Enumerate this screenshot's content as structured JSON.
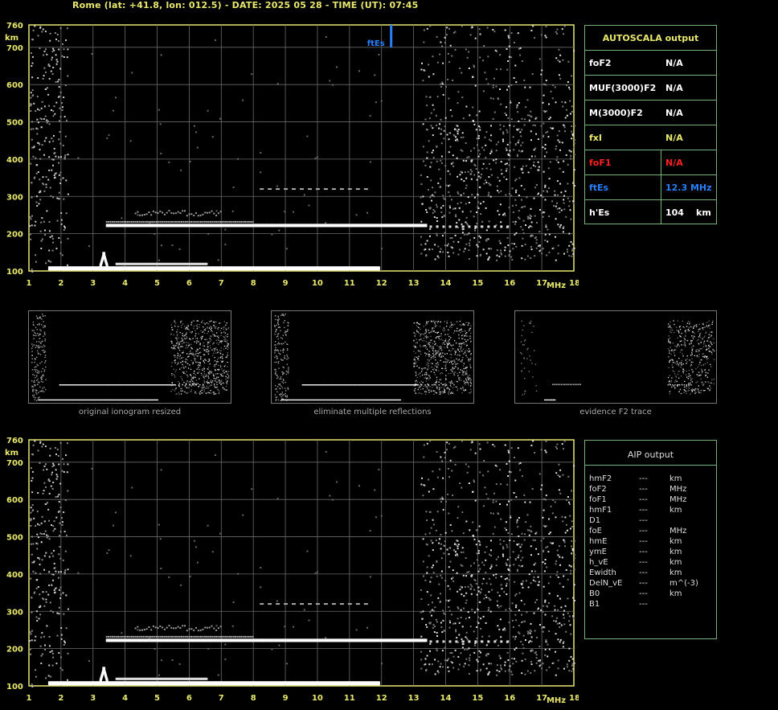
{
  "header": "Rome (lat: +41.8, lon: 012.5) - DATE: 2025 05 28 - TIME (UT): 07:45",
  "colors": {
    "axis": "#e8e870",
    "grid": "#6a6a6a",
    "table_border": "#7ab07a",
    "yellow": "#e8e870",
    "red": "#ff2020",
    "blue": "#2a7fff",
    "white": "#ffffff"
  },
  "ionogram": {
    "y_unit": "km",
    "x_unit": "MHz",
    "y_ticks": [
      "760",
      "700",
      "600",
      "500",
      "400",
      "300",
      "200",
      "100"
    ],
    "y_values": [
      760,
      700,
      600,
      500,
      400,
      300,
      200,
      100
    ],
    "x_ticks": [
      "1",
      "2",
      "3",
      "4",
      "5",
      "6",
      "7",
      "8",
      "9",
      "10",
      "11",
      "12",
      "13",
      "14",
      "15",
      "16",
      "17",
      "18"
    ],
    "x_values": [
      1,
      2,
      3,
      4,
      5,
      6,
      7,
      8,
      9,
      10,
      11,
      12,
      13,
      14,
      15,
      16,
      17,
      18
    ],
    "ftes_label": "ftEs",
    "ftes_mhz": 12.3,
    "e_trace": {
      "h": 108,
      "f_start": 1.6,
      "f_end": 11.9
    },
    "es_trace": {
      "h": 222,
      "f_start": 3.4,
      "f_end": 13.4
    }
  },
  "autoscala": {
    "title": "AUTOSCALA output",
    "rows": [
      {
        "key": "foF2",
        "value": "N/A",
        "unit": "",
        "color": "white"
      },
      {
        "key": "MUF(3000)F2",
        "value": "N/A",
        "unit": "",
        "color": "white"
      },
      {
        "key": "M(3000)F2",
        "value": "N/A",
        "unit": "",
        "color": "white"
      },
      {
        "key": "fxI",
        "value": "N/A",
        "unit": "",
        "color": "yellow"
      },
      {
        "key": "foF1",
        "value": "N/A",
        "unit": "",
        "color": "red"
      },
      {
        "key": "ftEs",
        "value": "12.3 MHz",
        "unit": "",
        "color": "blue"
      },
      {
        "key": "h'Es",
        "value": "104",
        "unit": "km",
        "color": "white"
      }
    ]
  },
  "thumbnails": [
    {
      "caption": "original ionogram resized"
    },
    {
      "caption": "eliminate multiple reflections"
    },
    {
      "caption": "evidence F2 trace"
    }
  ],
  "aip": {
    "title": "AIP output",
    "rows": [
      {
        "key": "hmF2",
        "value": "---",
        "unit": "km"
      },
      {
        "key": "foF2",
        "value": "---",
        "unit": "MHz"
      },
      {
        "key": "foF1",
        "value": "---",
        "unit": "MHz"
      },
      {
        "key": "hmF1",
        "value": "---",
        "unit": "km"
      },
      {
        "key": "D1",
        "value": "---",
        "unit": ""
      },
      {
        "key": "foE",
        "value": "---",
        "unit": "MHz"
      },
      {
        "key": "hmE",
        "value": "---",
        "unit": "km"
      },
      {
        "key": "ymE",
        "value": "---",
        "unit": "km"
      },
      {
        "key": "h_vE",
        "value": "---",
        "unit": "km"
      },
      {
        "key": "Ewidth",
        "value": "---",
        "unit": "km"
      },
      {
        "key": "DelN_vE",
        "value": "---",
        "unit": "m^(-3)"
      },
      {
        "key": "B0",
        "value": "---",
        "unit": "km"
      },
      {
        "key": "B1",
        "value": "---",
        "unit": ""
      }
    ]
  }
}
